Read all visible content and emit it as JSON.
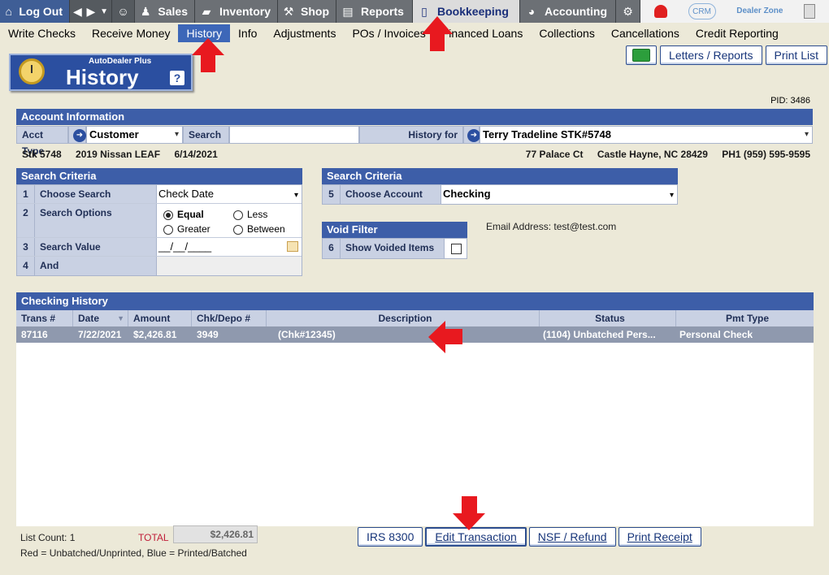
{
  "topnav": {
    "logout": "Log Out",
    "sales": "Sales",
    "inventory": "Inventory",
    "shop": "Shop",
    "reports": "Reports",
    "bookkeeping": "Bookkeeping",
    "accounting": "Accounting",
    "crm": "CRM",
    "dealer_zone": "Dealer Zone"
  },
  "subnav": [
    "Write Checks",
    "Receive Money",
    "History",
    "Info",
    "Adjustments",
    "POs / Invoices",
    "Financed Loans",
    "Collections",
    "Cancellations",
    "Credit Reporting"
  ],
  "toolbar": {
    "letters_reports": "Letters / Reports",
    "print_list": "Print List"
  },
  "header": {
    "app_name": "AutoDealer Plus",
    "title": "History",
    "help": "?"
  },
  "pid": "PID: 3486",
  "account": {
    "title": "Account Information",
    "acct_type_label": "Acct Type",
    "acct_type_value": "Customer",
    "search_label": "Search",
    "search_value": "",
    "history_for_label": "History for",
    "history_for_value": "Terry Tradeline STK#5748",
    "stk": "Stk 5748",
    "vehicle": "2019 Nissan LEAF",
    "date": "6/14/2021",
    "street": "77 Palace Ct",
    "city": "Castle Hayne, NC 28429",
    "phone": "PH1 (959) 595-9595"
  },
  "search_left": {
    "title": "Search Criteria",
    "rows": [
      {
        "num": "1",
        "label": "Choose Search",
        "value": "Check Date"
      },
      {
        "num": "2",
        "label": "Search Options"
      },
      {
        "num": "3",
        "label": "Search Value",
        "value": "__/__/____"
      },
      {
        "num": "4",
        "label": "And",
        "value": ""
      }
    ],
    "options": {
      "equal": "Equal",
      "less": "Less",
      "greater": "Greater",
      "between": "Between"
    }
  },
  "search_right": {
    "title": "Search Criteria",
    "num": "5",
    "label": "Choose Account",
    "value": "Checking"
  },
  "void_filter": {
    "title": "Void Filter",
    "num": "6",
    "label": "Show Voided Items"
  },
  "email": "Email Address: test@test.com",
  "grid": {
    "title": "Checking History",
    "columns": [
      "Trans #",
      "Date",
      "Amount",
      "Chk/Depo #",
      "Description",
      "Status",
      "Pmt Type"
    ],
    "rows": [
      {
        "trans": "87116",
        "date": "7/22/2021",
        "amount": "$2,426.81",
        "chk": "3949",
        "desc": "(Chk#12345)",
        "status": "(1104) Unbatched Pers...",
        "pmt": "Personal Check"
      }
    ]
  },
  "footer": {
    "list_count": "List Count: 1",
    "total_label": "TOTAL",
    "total_value": "$2,426.81",
    "legend": "Red = Unbatched/Unprinted, Blue = Printed/Batched"
  },
  "actions": {
    "irs": "IRS 8300",
    "edit": "Edit Transaction",
    "nsf": "NSF / Refund",
    "print_receipt": "Print Receipt"
  },
  "colors": {
    "accent": "#3d5ea8",
    "active_tab": "#3d67b8",
    "arrow": "#e8191f"
  }
}
